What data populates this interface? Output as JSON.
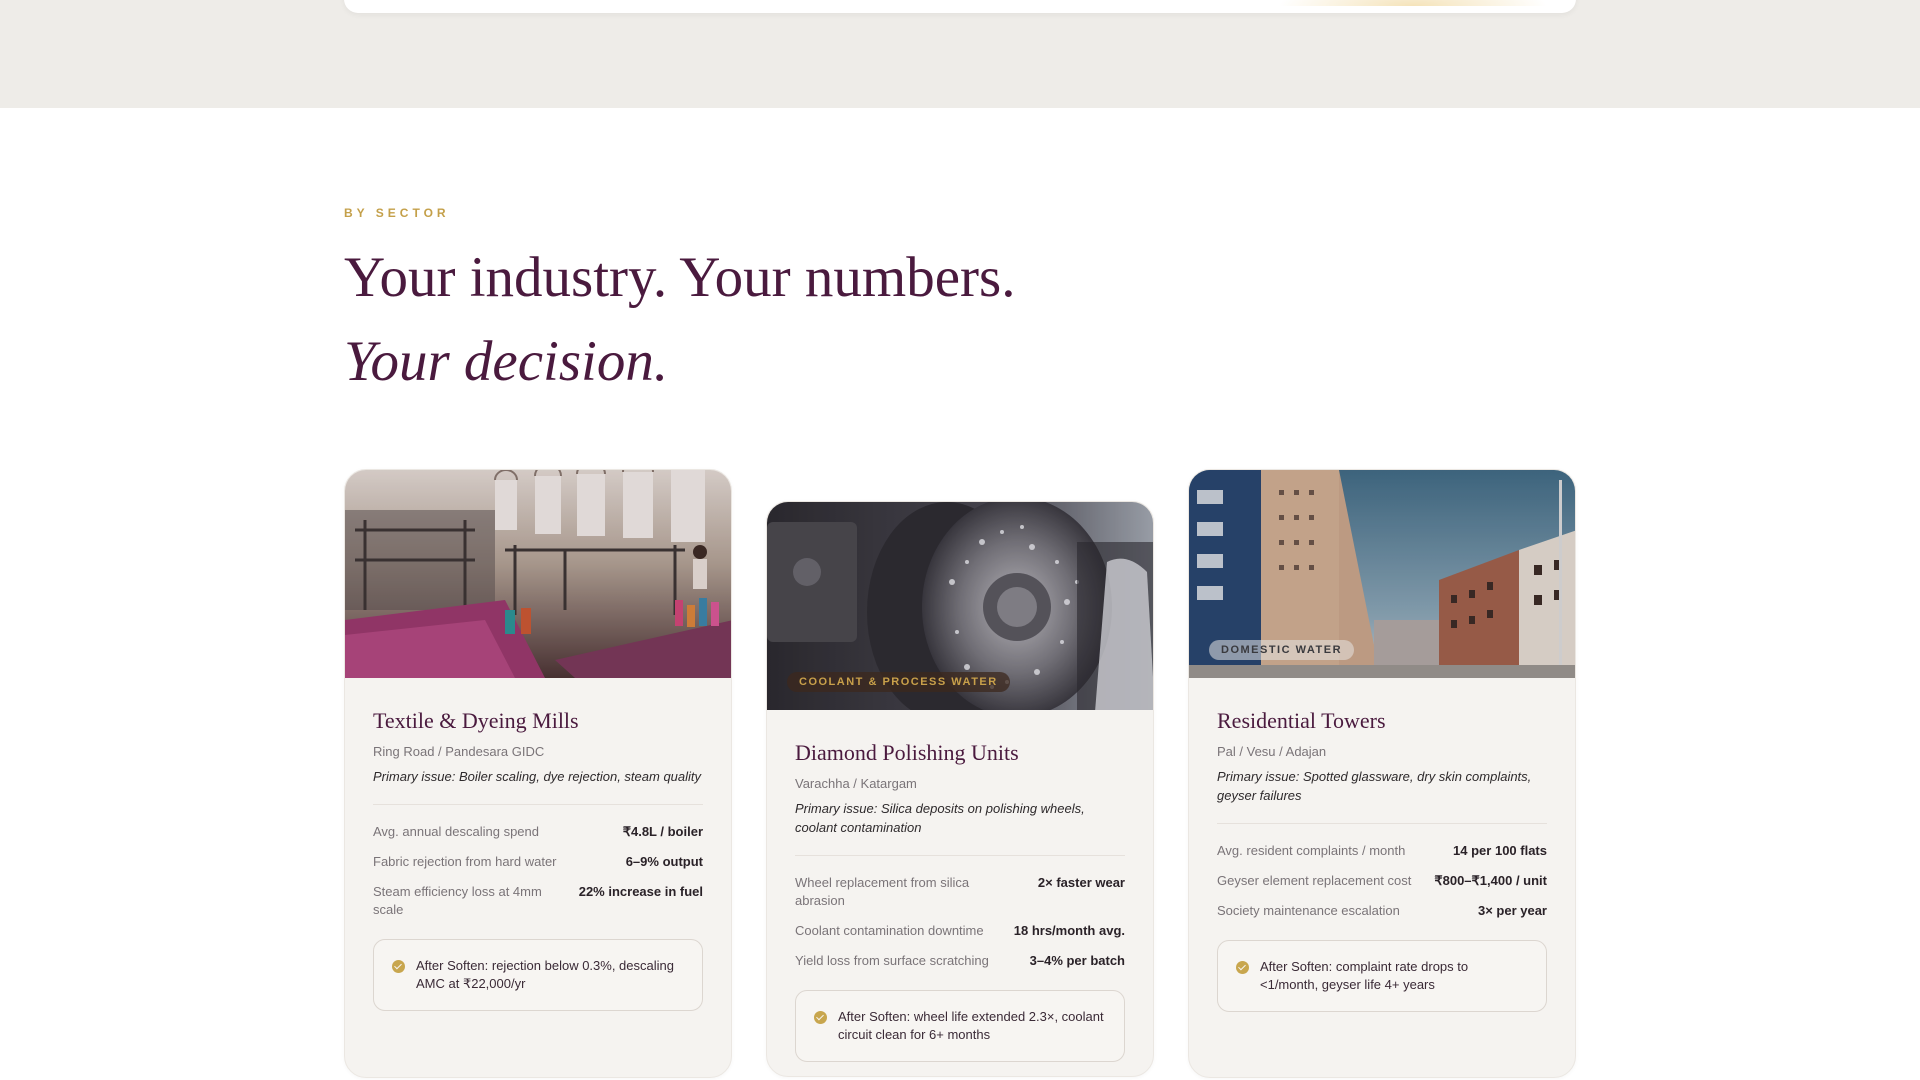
{
  "section": {
    "eyebrow": "BY SECTOR",
    "headline": "Your industry. Your numbers.",
    "headline_italic": "Your decision."
  },
  "colors": {
    "accent_gold": "#c4a04a",
    "plum": "#4a1a3e",
    "card_bg": "#f5f3f0"
  },
  "cards": [
    {
      "image": "textile-mill-photo",
      "badge": "",
      "title": "Textile & Dyeing Mills",
      "location": "Ring Road / Pandesara GIDC",
      "issue": "Primary issue: Boiler scaling, dye rejection, steam quality",
      "metrics": [
        {
          "label": "Avg. annual descaling spend",
          "value": "₹4.8L / boiler"
        },
        {
          "label": "Fabric rejection from hard water",
          "value": "6–9% output"
        },
        {
          "label": "Steam efficiency loss at 4mm scale",
          "value": "22% increase in fuel"
        }
      ],
      "after": "After Soften: rejection below 0.3%, descaling AMC at ₹22,000/yr"
    },
    {
      "image": "diamond-polishing-photo",
      "badge": "COOLANT & PROCESS WATER",
      "title": "Diamond Polishing Units",
      "location": "Varachha / Katargam",
      "issue": "Primary issue: Silica deposits on polishing wheels, coolant contamination",
      "metrics": [
        {
          "label": "Wheel replacement from silica abrasion",
          "value": "2× faster wear"
        },
        {
          "label": "Coolant contamination downtime",
          "value": "18 hrs/month avg."
        },
        {
          "label": "Yield loss from surface scratching",
          "value": "3–4% per batch"
        }
      ],
      "after": "After Soften: wheel life extended 2.3×, coolant circuit clean for 6+ months"
    },
    {
      "image": "residential-towers-photo",
      "badge": "DOMESTIC WATER",
      "title": "Residential Towers",
      "location": "Pal / Vesu / Adajan",
      "issue": "Primary issue: Spotted glassware, dry skin complaints, geyser failures",
      "metrics": [
        {
          "label": "Avg. resident complaints / month",
          "value": "14 per 100 flats"
        },
        {
          "label": "Geyser element replacement cost",
          "value": "₹800–₹1,400 / unit"
        },
        {
          "label": "Society maintenance escalation",
          "value": "3× per year"
        }
      ],
      "after": "After Soften: complaint rate drops to <1/month, geyser life 4+ years"
    }
  ]
}
